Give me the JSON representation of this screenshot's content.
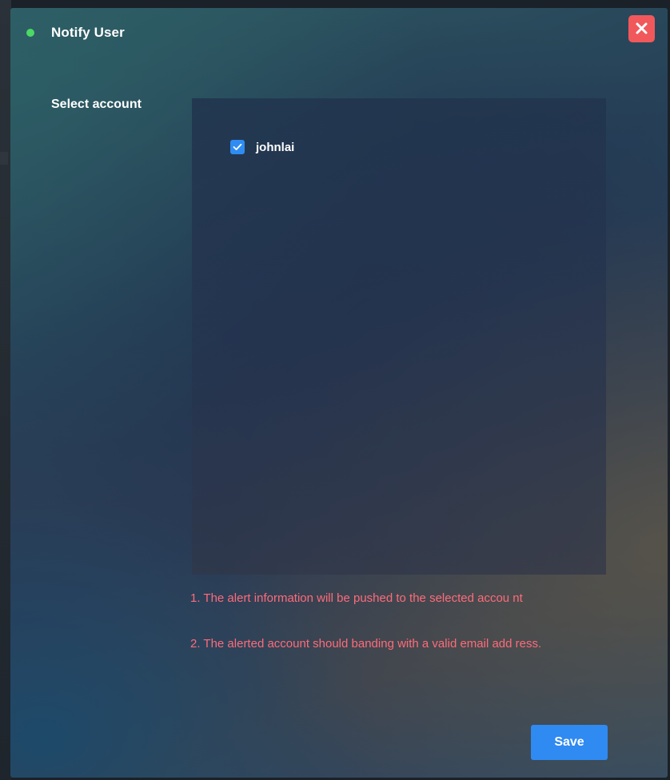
{
  "dialog": {
    "title": "Notify User",
    "status_color": "#4cd964",
    "close_icon": "close-icon"
  },
  "form": {
    "select_account_label": "Select account",
    "accounts": [
      {
        "name": "johnlai",
        "checked": true
      }
    ]
  },
  "notes": [
    "1. The alert information will be pushed to the selected accou nt",
    "2. The alerted account should banding with a valid email add ress."
  ],
  "actions": {
    "save_label": "Save"
  },
  "colors": {
    "accent": "#2f8af1",
    "danger": "#f1585b",
    "note_text": "#ff6b7a"
  }
}
